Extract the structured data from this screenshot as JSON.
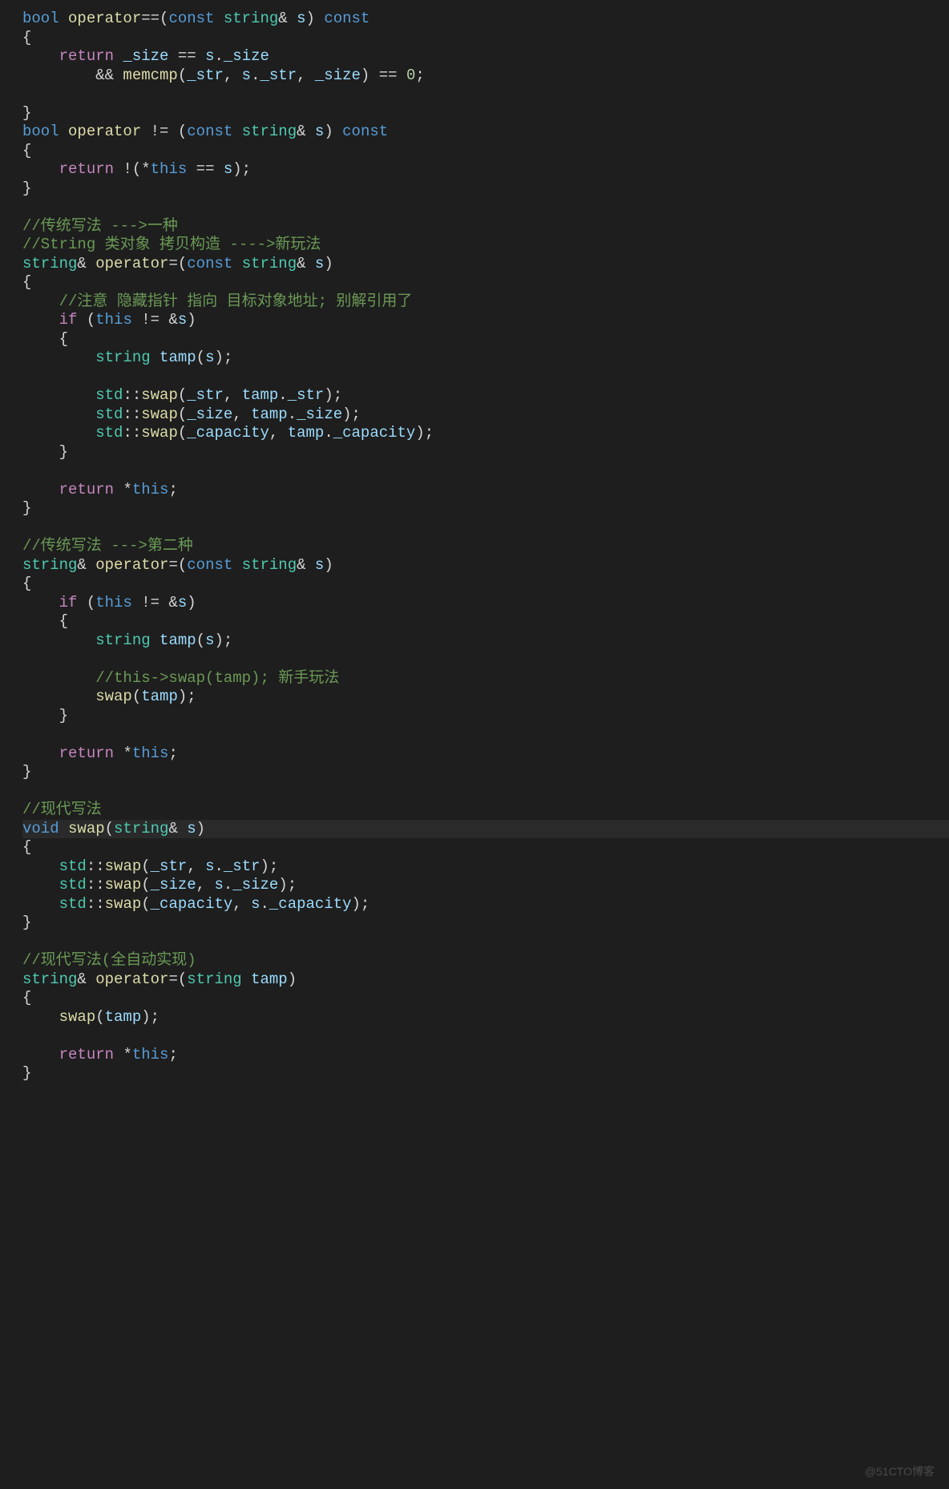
{
  "watermark": "@51CTO博客",
  "lines": [
    {
      "cls": "",
      "tokens": [
        {
          "t": "bool ",
          "c": "t-type"
        },
        {
          "t": "operator",
          "c": "t-func"
        },
        {
          "t": "==",
          "c": "t-punc"
        },
        {
          "t": "(",
          "c": "t-punc"
        },
        {
          "t": "const ",
          "c": "t-type"
        },
        {
          "t": "string",
          "c": "t-class"
        },
        {
          "t": "& ",
          "c": "t-punc"
        },
        {
          "t": "s",
          "c": "t-param"
        },
        {
          "t": ") ",
          "c": "t-punc"
        },
        {
          "t": "const",
          "c": "t-type"
        }
      ]
    },
    {
      "cls": "",
      "tokens": [
        {
          "t": "{",
          "c": "t-punc"
        }
      ]
    },
    {
      "cls": "",
      "tokens": [
        {
          "t": "    ",
          "c": ""
        },
        {
          "t": "return ",
          "c": "t-keyword"
        },
        {
          "t": "_size",
          "c": "t-member"
        },
        {
          "t": " == ",
          "c": "t-op"
        },
        {
          "t": "s",
          "c": "t-param"
        },
        {
          "t": ".",
          "c": "t-punc"
        },
        {
          "t": "_size",
          "c": "t-member"
        }
      ]
    },
    {
      "cls": "",
      "tokens": [
        {
          "t": "        && ",
          "c": "t-op"
        },
        {
          "t": "memcmp",
          "c": "t-func"
        },
        {
          "t": "(",
          "c": "t-punc"
        },
        {
          "t": "_str",
          "c": "t-member"
        },
        {
          "t": ", ",
          "c": "t-punc"
        },
        {
          "t": "s",
          "c": "t-param"
        },
        {
          "t": ".",
          "c": "t-punc"
        },
        {
          "t": "_str",
          "c": "t-member"
        },
        {
          "t": ", ",
          "c": "t-punc"
        },
        {
          "t": "_size",
          "c": "t-member"
        },
        {
          "t": ") == ",
          "c": "t-op"
        },
        {
          "t": "0",
          "c": "t-num"
        },
        {
          "t": ";",
          "c": "t-punc"
        }
      ]
    },
    {
      "cls": "",
      "tokens": [
        {
          "t": " ",
          "c": ""
        }
      ]
    },
    {
      "cls": "",
      "tokens": [
        {
          "t": "}",
          "c": "t-punc"
        }
      ]
    },
    {
      "cls": "",
      "tokens": [
        {
          "t": "bool ",
          "c": "t-type"
        },
        {
          "t": "operator ",
          "c": "t-func"
        },
        {
          "t": "!= ",
          "c": "t-punc"
        },
        {
          "t": "(",
          "c": "t-punc"
        },
        {
          "t": "const ",
          "c": "t-type"
        },
        {
          "t": "string",
          "c": "t-class"
        },
        {
          "t": "& ",
          "c": "t-punc"
        },
        {
          "t": "s",
          "c": "t-param"
        },
        {
          "t": ") ",
          "c": "t-punc"
        },
        {
          "t": "const",
          "c": "t-type"
        }
      ]
    },
    {
      "cls": "",
      "tokens": [
        {
          "t": "{",
          "c": "t-punc"
        }
      ]
    },
    {
      "cls": "",
      "tokens": [
        {
          "t": "    ",
          "c": ""
        },
        {
          "t": "return ",
          "c": "t-keyword"
        },
        {
          "t": "!(*",
          "c": "t-op"
        },
        {
          "t": "this",
          "c": "t-this"
        },
        {
          "t": " == ",
          "c": "t-op"
        },
        {
          "t": "s",
          "c": "t-param"
        },
        {
          "t": ");",
          "c": "t-punc"
        }
      ]
    },
    {
      "cls": "",
      "tokens": [
        {
          "t": "}",
          "c": "t-punc"
        }
      ]
    },
    {
      "cls": "",
      "tokens": [
        {
          "t": "",
          "c": ""
        }
      ]
    },
    {
      "cls": "",
      "tokens": [
        {
          "t": "//传统写法 --->一种",
          "c": "t-comment"
        }
      ]
    },
    {
      "cls": "",
      "tokens": [
        {
          "t": "//String 类对象 拷贝构造 ---->新玩法",
          "c": "t-comment"
        }
      ]
    },
    {
      "cls": "",
      "tokens": [
        {
          "t": "string",
          "c": "t-class"
        },
        {
          "t": "& ",
          "c": "t-punc"
        },
        {
          "t": "operator",
          "c": "t-func"
        },
        {
          "t": "=(",
          "c": "t-punc"
        },
        {
          "t": "const ",
          "c": "t-type"
        },
        {
          "t": "string",
          "c": "t-class"
        },
        {
          "t": "& ",
          "c": "t-punc"
        },
        {
          "t": "s",
          "c": "t-param"
        },
        {
          "t": ")",
          "c": "t-punc"
        }
      ]
    },
    {
      "cls": "",
      "tokens": [
        {
          "t": "{",
          "c": "t-punc"
        }
      ]
    },
    {
      "cls": "",
      "tokens": [
        {
          "t": "    ",
          "c": ""
        },
        {
          "t": "//注意 隐藏指针 指向 目标对象地址; 别解引用了",
          "c": "t-comment"
        }
      ]
    },
    {
      "cls": "",
      "tokens": [
        {
          "t": "    ",
          "c": ""
        },
        {
          "t": "if ",
          "c": "t-keyword"
        },
        {
          "t": "(",
          "c": "t-punc"
        },
        {
          "t": "this",
          "c": "t-this"
        },
        {
          "t": " != &",
          "c": "t-op"
        },
        {
          "t": "s",
          "c": "t-param"
        },
        {
          "t": ")",
          "c": "t-punc"
        }
      ]
    },
    {
      "cls": "",
      "tokens": [
        {
          "t": "    {",
          "c": "t-punc"
        }
      ]
    },
    {
      "cls": "",
      "tokens": [
        {
          "t": "        ",
          "c": ""
        },
        {
          "t": "string ",
          "c": "t-class"
        },
        {
          "t": "tamp",
          "c": "t-param"
        },
        {
          "t": "(",
          "c": "t-punc"
        },
        {
          "t": "s",
          "c": "t-param"
        },
        {
          "t": ");",
          "c": "t-punc"
        }
      ]
    },
    {
      "cls": "",
      "tokens": [
        {
          "t": "",
          "c": ""
        }
      ]
    },
    {
      "cls": "",
      "tokens": [
        {
          "t": "        ",
          "c": ""
        },
        {
          "t": "std",
          "c": "t-class"
        },
        {
          "t": "::",
          "c": "t-punc"
        },
        {
          "t": "swap",
          "c": "t-func"
        },
        {
          "t": "(",
          "c": "t-punc"
        },
        {
          "t": "_str",
          "c": "t-member"
        },
        {
          "t": ", ",
          "c": "t-punc"
        },
        {
          "t": "tamp",
          "c": "t-param"
        },
        {
          "t": ".",
          "c": "t-punc"
        },
        {
          "t": "_str",
          "c": "t-member"
        },
        {
          "t": ");",
          "c": "t-punc"
        }
      ]
    },
    {
      "cls": "",
      "tokens": [
        {
          "t": "        ",
          "c": ""
        },
        {
          "t": "std",
          "c": "t-class"
        },
        {
          "t": "::",
          "c": "t-punc"
        },
        {
          "t": "swap",
          "c": "t-func"
        },
        {
          "t": "(",
          "c": "t-punc"
        },
        {
          "t": "_size",
          "c": "t-member"
        },
        {
          "t": ", ",
          "c": "t-punc"
        },
        {
          "t": "tamp",
          "c": "t-param"
        },
        {
          "t": ".",
          "c": "t-punc"
        },
        {
          "t": "_size",
          "c": "t-member"
        },
        {
          "t": ");",
          "c": "t-punc"
        }
      ]
    },
    {
      "cls": "",
      "tokens": [
        {
          "t": "        ",
          "c": ""
        },
        {
          "t": "std",
          "c": "t-class"
        },
        {
          "t": "::",
          "c": "t-punc"
        },
        {
          "t": "swap",
          "c": "t-func"
        },
        {
          "t": "(",
          "c": "t-punc"
        },
        {
          "t": "_capacity",
          "c": "t-member"
        },
        {
          "t": ", ",
          "c": "t-punc"
        },
        {
          "t": "tamp",
          "c": "t-param"
        },
        {
          "t": ".",
          "c": "t-punc"
        },
        {
          "t": "_capacity",
          "c": "t-member"
        },
        {
          "t": ");",
          "c": "t-punc"
        }
      ]
    },
    {
      "cls": "",
      "tokens": [
        {
          "t": "    }",
          "c": "t-punc"
        }
      ]
    },
    {
      "cls": "",
      "tokens": [
        {
          "t": "",
          "c": ""
        }
      ]
    },
    {
      "cls": "",
      "tokens": [
        {
          "t": "    ",
          "c": ""
        },
        {
          "t": "return ",
          "c": "t-keyword"
        },
        {
          "t": "*",
          "c": "t-op"
        },
        {
          "t": "this",
          "c": "t-this"
        },
        {
          "t": ";",
          "c": "t-punc"
        }
      ]
    },
    {
      "cls": "",
      "tokens": [
        {
          "t": "}",
          "c": "t-punc"
        }
      ]
    },
    {
      "cls": "",
      "tokens": [
        {
          "t": "",
          "c": ""
        }
      ]
    },
    {
      "cls": "",
      "tokens": [
        {
          "t": "//传统写法 --->第二种",
          "c": "t-comment"
        }
      ]
    },
    {
      "cls": "",
      "tokens": [
        {
          "t": "string",
          "c": "t-class"
        },
        {
          "t": "& ",
          "c": "t-punc"
        },
        {
          "t": "operator",
          "c": "t-func"
        },
        {
          "t": "=(",
          "c": "t-punc"
        },
        {
          "t": "const ",
          "c": "t-type"
        },
        {
          "t": "string",
          "c": "t-class"
        },
        {
          "t": "& ",
          "c": "t-punc"
        },
        {
          "t": "s",
          "c": "t-param"
        },
        {
          "t": ")",
          "c": "t-punc"
        }
      ]
    },
    {
      "cls": "",
      "tokens": [
        {
          "t": "{",
          "c": "t-punc"
        }
      ]
    },
    {
      "cls": "",
      "tokens": [
        {
          "t": "    ",
          "c": ""
        },
        {
          "t": "if ",
          "c": "t-keyword"
        },
        {
          "t": "(",
          "c": "t-punc"
        },
        {
          "t": "this",
          "c": "t-this"
        },
        {
          "t": " != &",
          "c": "t-op"
        },
        {
          "t": "s",
          "c": "t-param"
        },
        {
          "t": ")",
          "c": "t-punc"
        }
      ]
    },
    {
      "cls": "",
      "tokens": [
        {
          "t": "    {",
          "c": "t-punc"
        }
      ]
    },
    {
      "cls": "",
      "tokens": [
        {
          "t": "        ",
          "c": ""
        },
        {
          "t": "string ",
          "c": "t-class"
        },
        {
          "t": "tamp",
          "c": "t-param"
        },
        {
          "t": "(",
          "c": "t-punc"
        },
        {
          "t": "s",
          "c": "t-param"
        },
        {
          "t": ");",
          "c": "t-punc"
        }
      ]
    },
    {
      "cls": "",
      "tokens": [
        {
          "t": "",
          "c": ""
        }
      ]
    },
    {
      "cls": "",
      "tokens": [
        {
          "t": "        ",
          "c": ""
        },
        {
          "t": "//this->swap(tamp); 新手玩法",
          "c": "t-comment"
        }
      ]
    },
    {
      "cls": "",
      "tokens": [
        {
          "t": "        ",
          "c": ""
        },
        {
          "t": "swap",
          "c": "t-func"
        },
        {
          "t": "(",
          "c": "t-punc"
        },
        {
          "t": "tamp",
          "c": "t-param"
        },
        {
          "t": ");",
          "c": "t-punc"
        }
      ]
    },
    {
      "cls": "",
      "tokens": [
        {
          "t": "    }",
          "c": "t-punc"
        }
      ]
    },
    {
      "cls": "",
      "tokens": [
        {
          "t": "",
          "c": ""
        }
      ]
    },
    {
      "cls": "",
      "tokens": [
        {
          "t": "    ",
          "c": ""
        },
        {
          "t": "return ",
          "c": "t-keyword"
        },
        {
          "t": "*",
          "c": "t-op"
        },
        {
          "t": "this",
          "c": "t-this"
        },
        {
          "t": ";",
          "c": "t-punc"
        }
      ]
    },
    {
      "cls": "",
      "tokens": [
        {
          "t": "}",
          "c": "t-punc"
        }
      ]
    },
    {
      "cls": "",
      "tokens": [
        {
          "t": "",
          "c": ""
        }
      ]
    },
    {
      "cls": "",
      "tokens": [
        {
          "t": "//现代写法",
          "c": "t-comment"
        }
      ]
    },
    {
      "cls": "highlight-line",
      "tokens": [
        {
          "t": "void ",
          "c": "t-type"
        },
        {
          "t": "swap",
          "c": "t-func"
        },
        {
          "t": "(",
          "c": "t-punc"
        },
        {
          "t": "string",
          "c": "t-class"
        },
        {
          "t": "& ",
          "c": "t-punc"
        },
        {
          "t": "s",
          "c": "t-param"
        },
        {
          "t": ")",
          "c": "t-punc"
        }
      ]
    },
    {
      "cls": "",
      "tokens": [
        {
          "t": "{",
          "c": "t-punc"
        }
      ]
    },
    {
      "cls": "",
      "tokens": [
        {
          "t": "    ",
          "c": ""
        },
        {
          "t": "std",
          "c": "t-class"
        },
        {
          "t": "::",
          "c": "t-punc"
        },
        {
          "t": "swap",
          "c": "t-func"
        },
        {
          "t": "(",
          "c": "t-punc"
        },
        {
          "t": "_str",
          "c": "t-member"
        },
        {
          "t": ", ",
          "c": "t-punc"
        },
        {
          "t": "s",
          "c": "t-param"
        },
        {
          "t": ".",
          "c": "t-punc"
        },
        {
          "t": "_str",
          "c": "t-member"
        },
        {
          "t": ");",
          "c": "t-punc"
        }
      ]
    },
    {
      "cls": "",
      "tokens": [
        {
          "t": "    ",
          "c": ""
        },
        {
          "t": "std",
          "c": "t-class"
        },
        {
          "t": "::",
          "c": "t-punc"
        },
        {
          "t": "swap",
          "c": "t-func"
        },
        {
          "t": "(",
          "c": "t-punc"
        },
        {
          "t": "_size",
          "c": "t-member"
        },
        {
          "t": ", ",
          "c": "t-punc"
        },
        {
          "t": "s",
          "c": "t-param"
        },
        {
          "t": ".",
          "c": "t-punc"
        },
        {
          "t": "_size",
          "c": "t-member"
        },
        {
          "t": ");",
          "c": "t-punc"
        }
      ]
    },
    {
      "cls": "",
      "tokens": [
        {
          "t": "    ",
          "c": ""
        },
        {
          "t": "std",
          "c": "t-class"
        },
        {
          "t": "::",
          "c": "t-punc"
        },
        {
          "t": "swap",
          "c": "t-func"
        },
        {
          "t": "(",
          "c": "t-punc"
        },
        {
          "t": "_capacity",
          "c": "t-member"
        },
        {
          "t": ", ",
          "c": "t-punc"
        },
        {
          "t": "s",
          "c": "t-param"
        },
        {
          "t": ".",
          "c": "t-punc"
        },
        {
          "t": "_capacity",
          "c": "t-member"
        },
        {
          "t": ");",
          "c": "t-punc"
        }
      ]
    },
    {
      "cls": "",
      "tokens": [
        {
          "t": "}",
          "c": "t-punc"
        }
      ]
    },
    {
      "cls": "",
      "tokens": [
        {
          "t": "",
          "c": ""
        }
      ]
    },
    {
      "cls": "",
      "tokens": [
        {
          "t": "//现代写法(全自动实现)",
          "c": "t-comment"
        }
      ]
    },
    {
      "cls": "",
      "tokens": [
        {
          "t": "string",
          "c": "t-class"
        },
        {
          "t": "& ",
          "c": "t-punc"
        },
        {
          "t": "operator",
          "c": "t-func"
        },
        {
          "t": "=(",
          "c": "t-punc"
        },
        {
          "t": "string ",
          "c": "t-class"
        },
        {
          "t": "tamp",
          "c": "t-param"
        },
        {
          "t": ")",
          "c": "t-punc"
        }
      ]
    },
    {
      "cls": "",
      "tokens": [
        {
          "t": "{",
          "c": "t-punc"
        }
      ]
    },
    {
      "cls": "",
      "tokens": [
        {
          "t": "    ",
          "c": ""
        },
        {
          "t": "swap",
          "c": "t-func"
        },
        {
          "t": "(",
          "c": "t-punc"
        },
        {
          "t": "tamp",
          "c": "t-param"
        },
        {
          "t": ");",
          "c": "t-punc"
        }
      ]
    },
    {
      "cls": "",
      "tokens": [
        {
          "t": "",
          "c": ""
        }
      ]
    },
    {
      "cls": "",
      "tokens": [
        {
          "t": "    ",
          "c": ""
        },
        {
          "t": "return ",
          "c": "t-keyword"
        },
        {
          "t": "*",
          "c": "t-op"
        },
        {
          "t": "this",
          "c": "t-this"
        },
        {
          "t": ";",
          "c": "t-punc"
        }
      ]
    },
    {
      "cls": "",
      "tokens": [
        {
          "t": "}",
          "c": "t-punc"
        }
      ]
    }
  ]
}
